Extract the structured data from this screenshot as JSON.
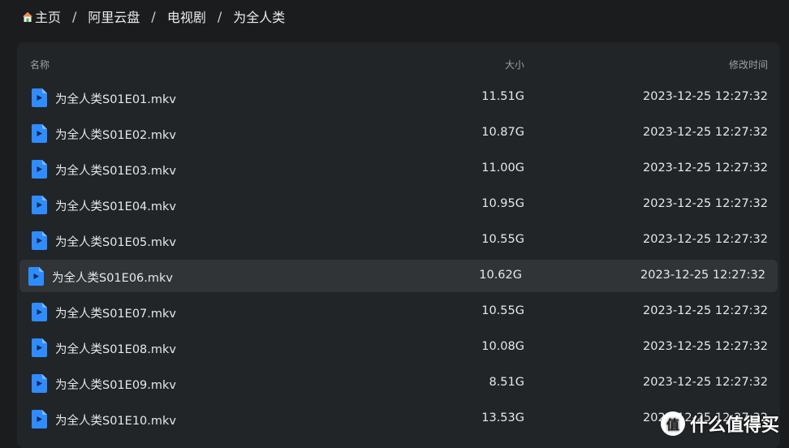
{
  "breadcrumb": {
    "items": [
      "主页",
      "阿里云盘",
      "电视剧",
      "为全人类"
    ],
    "separator": "/"
  },
  "table": {
    "headers": {
      "name": "名称",
      "size": "大小",
      "time": "修改时间"
    },
    "rows": [
      {
        "name": "为全人类S01E01.mkv",
        "size": "11.51G",
        "time": "2023-12-25 12:27:32"
      },
      {
        "name": "为全人类S01E02.mkv",
        "size": "10.87G",
        "time": "2023-12-25 12:27:32"
      },
      {
        "name": "为全人类S01E03.mkv",
        "size": "11.00G",
        "time": "2023-12-25 12:27:32"
      },
      {
        "name": "为全人类S01E04.mkv",
        "size": "10.95G",
        "time": "2023-12-25 12:27:32"
      },
      {
        "name": "为全人类S01E05.mkv",
        "size": "10.55G",
        "time": "2023-12-25 12:27:32"
      },
      {
        "name": "为全人类S01E06.mkv",
        "size": "10.62G",
        "time": "2023-12-25 12:27:32"
      },
      {
        "name": "为全人类S01E07.mkv",
        "size": "10.55G",
        "time": "2023-12-25 12:27:32"
      },
      {
        "name": "为全人类S01E08.mkv",
        "size": "10.08G",
        "time": "2023-12-25 12:27:32"
      },
      {
        "name": "为全人类S01E09.mkv",
        "size": "8.51G",
        "time": "2023-12-25 12:27:32"
      },
      {
        "name": "为全人类S01E10.mkv",
        "size": "13.53G",
        "time": "2023-12-25 12:27:32"
      }
    ]
  },
  "watermark": {
    "badge": "值",
    "text": "什么值得买"
  },
  "colors": {
    "background": "#1a1c1e",
    "panel": "#222527",
    "row_hover": "#303436",
    "file_icon": "#2f8cff",
    "header_text": "#9aa0a6"
  },
  "icons": {
    "home": "home-icon",
    "file": "video-file-icon"
  }
}
